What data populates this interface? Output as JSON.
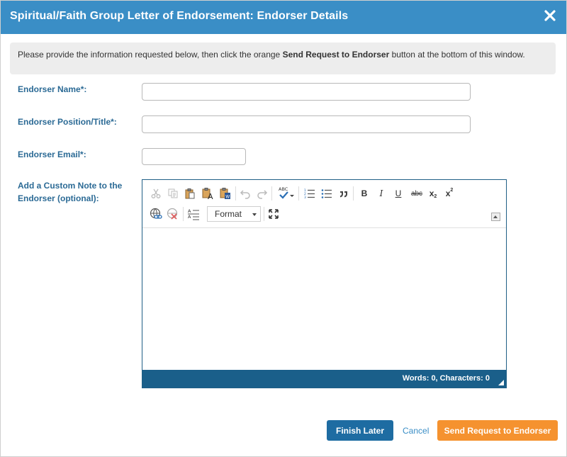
{
  "dialog": {
    "title": "Spiritual/Faith Group Letter of Endorsement: Endorser Details"
  },
  "info": {
    "before": "Please provide the information requested below, then click the orange ",
    "bold": "Send Request to Endorser",
    "after": " button at the bottom of this window."
  },
  "fields": {
    "name_label": "Endorser Name*:",
    "name_value": "",
    "position_label": "Endorser Position/Title*:",
    "position_value": "",
    "email_label": "Endorser Email*:",
    "email_value": "",
    "note_label_line1": "Add a Custom Note to the",
    "note_label_line2": "Endorser (optional):"
  },
  "editor": {
    "format_label": "Format",
    "bold_glyph": "B",
    "italic_glyph": "I",
    "underline_glyph": "U",
    "strike_glyph": "abc",
    "subscript_glyph": "x",
    "superscript_glyph": "x",
    "spell_glyph": "ABC",
    "word_count": "Words: 0, Characters: 0",
    "content": "",
    "icons": [
      "cut-icon",
      "copy-icon",
      "paste-icon",
      "paste-text-icon",
      "paste-word-icon",
      "undo-icon",
      "redo-icon",
      "spellcheck-icon",
      "numbered-list-icon",
      "bulleted-list-icon",
      "blockquote-icon",
      "bold-icon",
      "italic-icon",
      "underline-icon",
      "strikethrough-icon",
      "subscript-icon",
      "superscript-icon",
      "link-icon",
      "unlink-icon",
      "remove-format-icon",
      "maximize-icon",
      "collapse-toolbar-icon"
    ]
  },
  "buttons": {
    "finish_later": "Finish Later",
    "cancel": "Cancel",
    "send": "Send Request to Endorser"
  },
  "colors": {
    "titlebar": "#3a8ec6",
    "label": "#2b6a95",
    "statusbar": "#1a5f8a",
    "finish_button": "#1e6ca2",
    "send_button": "#f5922f"
  }
}
